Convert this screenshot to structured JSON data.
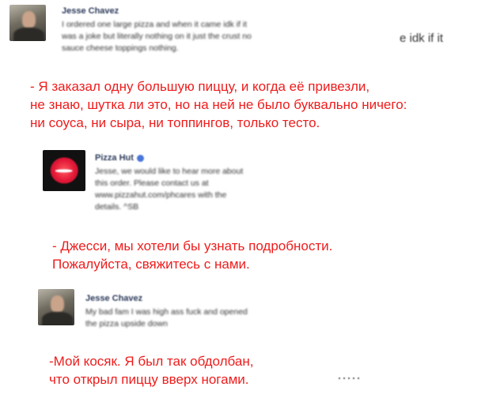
{
  "posts": [
    {
      "author": "Jesse Chavez",
      "text": "I ordered one large pizza and when it came idk if it\nwas a joke but literally nothing on it just the crust no\nsauce cheese toppings nothing.",
      "cut_text": "e idk if it",
      "translation": "- Я заказал одну большую пиццу, и когда её привезли,\nне знаю, шутка ли это, но на ней не было буквально ничего:\nни соуса, ни сыра, ни топпингов, только тесто."
    },
    {
      "author": "Pizza Hut",
      "text": "Jesse, we would like to hear more about\nthis order. Please contact us at\nwww.pizzahut.com/phcares with the\ndetails. ^SB",
      "translation": "- Джесси, мы хотели бы узнать подробности.\nПожалуйста, свяжитесь с нами."
    },
    {
      "author": "Jesse Chavez",
      "text": "My bad fam I was high ass fuck and opened\nthe pizza upside down",
      "translation": "-Мой косяк. Я был так обдолбан,\nчто открыл пиццу вверх ногами."
    }
  ],
  "colors": {
    "translation": "#ee1c1c",
    "name": "#2d3b5b",
    "verified": "#4a76d8",
    "brand": "#e31837"
  }
}
